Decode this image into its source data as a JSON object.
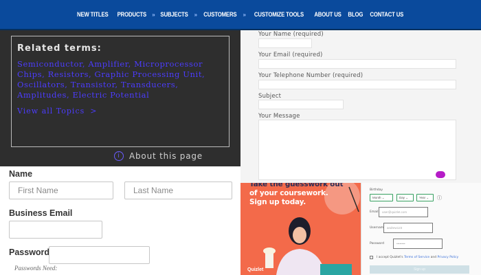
{
  "nav": {
    "items": [
      "NEW TITLES",
      "PRODUCTS",
      "SUBJECTS",
      "CUSTOMERS",
      "CUSTOMIZE TOOLS",
      "ABOUT US",
      "BLOG",
      "CONTACT US"
    ],
    "separator": "»",
    "bg_color": "#0a4a9c"
  },
  "related": {
    "title": "Related terms:",
    "terms": "Semiconductor, Amplifier, Microprocessor Chips, Resistors, Graphic Processing Unit, Oscillators, Transistor, Transducers, Amplitudes, Electric Potential",
    "view_all": "View all Topics",
    "view_all_icon": "chevron-right-icon",
    "about": "About this page",
    "link_color": "#4c3cff"
  },
  "contact": {
    "name_label": "Your Name (required)",
    "email_label": "Your Email (required)",
    "phone_label": "Your Telephone Number (required)",
    "subject_label": "Subject",
    "message_label": "Your Message"
  },
  "signup": {
    "name_label": "Name",
    "first_placeholder": "First Name",
    "last_placeholder": "Last Name",
    "email_label": "Business Email",
    "password_label": "Password",
    "password_hint": "Passwords Need:"
  },
  "quizlet": {
    "headline_1": "Take the guesswork out",
    "headline_2": "of your coursework.",
    "headline_3": "Sign up today.",
    "brand": "Quizlet",
    "birthday_label": "Birthday",
    "month": "Month",
    "day": "Day",
    "year": "Year",
    "email_label": "Email",
    "email_placeholder": "user@quizlet.com",
    "username_label": "Username",
    "username_placeholder": "andrew123",
    "password_label": "Password",
    "password_placeholder": "••••••••",
    "terms_text_1": "I accept Quizlet's",
    "terms_link_1": "Terms of Service",
    "terms_text_2": "and",
    "terms_link_2": "Privacy Policy",
    "signup_button": "Sign up",
    "promo_color": "#f36a4a"
  }
}
